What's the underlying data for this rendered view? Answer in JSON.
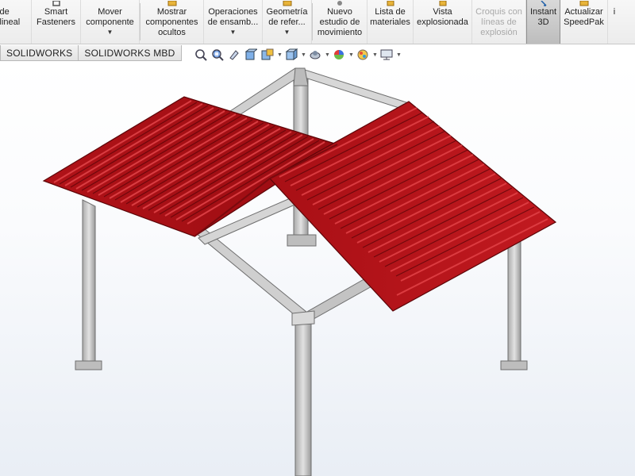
{
  "ribbon": {
    "buttons": [
      {
        "id": "linear-pattern",
        "label": "de\nlineal",
        "icon": "linear-pattern-icon",
        "dropdown": false,
        "disabled": false,
        "active": false
      },
      {
        "id": "smart-fasteners",
        "label": "Smart\nFasteners",
        "icon": "smart-fasteners-icon",
        "dropdown": false,
        "disabled": false,
        "active": false
      },
      {
        "id": "move-component",
        "label": "Mover\ncomponente",
        "icon": "move-component-icon",
        "dropdown": true,
        "disabled": false,
        "active": false
      },
      {
        "id": "show-hidden",
        "label": "Mostrar\ncomponentes\nocultos",
        "icon": "show-hidden-components-icon",
        "dropdown": false,
        "disabled": false,
        "active": false
      },
      {
        "id": "assembly-features",
        "label": "Operaciones\nde ensamb...",
        "icon": "assembly-features-icon",
        "dropdown": true,
        "disabled": false,
        "active": false
      },
      {
        "id": "reference-geometry",
        "label": "Geometría\nde refer...",
        "icon": "reference-geometry-icon",
        "dropdown": true,
        "disabled": false,
        "active": false
      },
      {
        "id": "new-motion-study",
        "label": "Nuevo\nestudio de\nmovimiento",
        "icon": "motion-study-icon",
        "dropdown": false,
        "disabled": false,
        "active": false
      },
      {
        "id": "bill-of-materials",
        "label": "Lista de\nmateriales",
        "icon": "bill-of-materials-icon",
        "dropdown": false,
        "disabled": false,
        "active": false
      },
      {
        "id": "exploded-view",
        "label": "Vista\nexplosionada",
        "icon": "exploded-view-icon",
        "dropdown": false,
        "disabled": false,
        "active": false
      },
      {
        "id": "explode-line-sketch",
        "label": "Croquis con\nlíneas de\nexplosión",
        "icon": "explode-line-sketch-icon",
        "dropdown": false,
        "disabled": true,
        "active": false
      },
      {
        "id": "instant-3d",
        "label": "Instant\n3D",
        "icon": "instant-3d-icon",
        "dropdown": false,
        "disabled": false,
        "active": true
      },
      {
        "id": "update-speedpak",
        "label": "Actualizar\nSpeedPak",
        "icon": "speedpak-icon",
        "dropdown": false,
        "disabled": false,
        "active": false
      },
      {
        "id": "overflow",
        "label": "i",
        "icon": "overflow-icon",
        "dropdown": false,
        "disabled": false,
        "active": false
      }
    ]
  },
  "tabs": [
    {
      "id": "solidworks",
      "label": "SOLIDWORKS"
    },
    {
      "id": "solidworks-mbd",
      "label": "SOLIDWORKS MBD"
    }
  ],
  "heads_up_toolbar": [
    {
      "icon": "zoom-to-fit-icon",
      "dropdown": false
    },
    {
      "icon": "zoom-to-area-icon",
      "dropdown": false
    },
    {
      "icon": "previous-view-icon",
      "dropdown": false
    },
    {
      "icon": "section-view-icon",
      "dropdown": false
    },
    {
      "icon": "dynamic-annotation-view-icon",
      "dropdown": false
    },
    {
      "icon": "view-orientation-icon",
      "dropdown": true
    },
    {
      "icon": "display-style-icon",
      "dropdown": true
    },
    {
      "icon": "hide-show-items-icon",
      "dropdown": true
    },
    {
      "icon": "edit-appearance-icon",
      "dropdown": true
    },
    {
      "icon": "apply-scene-icon",
      "dropdown": true
    },
    {
      "icon": "view-settings-icon",
      "dropdown": true
    }
  ],
  "model": {
    "name": "carport-frame-with-corrugated-roof",
    "roof_color": "#c4161c",
    "frame_color": "#c8c8c8"
  },
  "colors": {
    "ribbon_bg": "#efefef",
    "active_bg": "#c6c6c6",
    "disabled_text": "#a9a9a9",
    "viewport_top": "#ffffff",
    "viewport_bottom": "#e9eef5"
  }
}
